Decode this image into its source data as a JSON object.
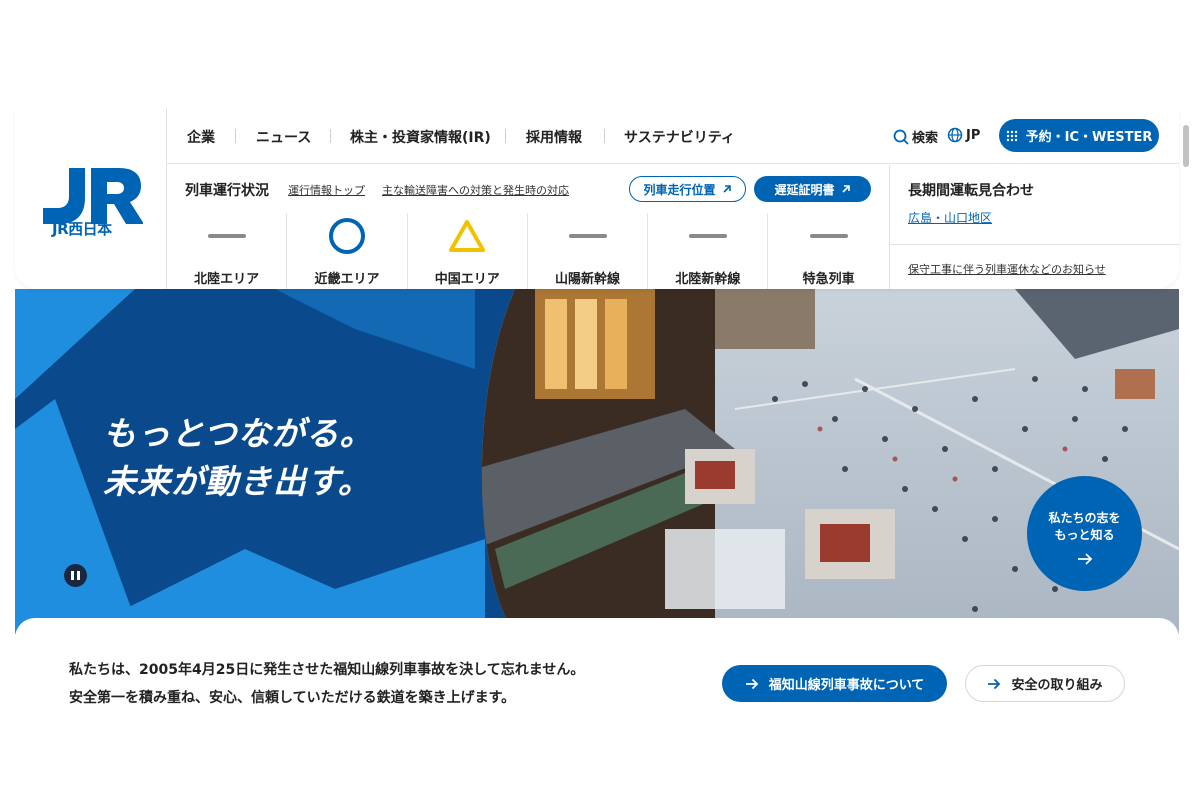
{
  "logo": {
    "sub_label": "JR西日本"
  },
  "top_nav": {
    "items": [
      "企業",
      "ニュース",
      "株主・投資家情報(IR)",
      "採用情報",
      "サステナビリティ"
    ],
    "search_label": "検索",
    "lang_label": "JP",
    "reserve_label": "予約・IC・WESTER"
  },
  "train_status": {
    "title": "列車運行状況",
    "link_top": "運行情報トップ",
    "link_measures": "主な輸送障害への対策と発生時の対応",
    "position_label": "列車走行位置",
    "delay_cert_label": "遅延証明書",
    "areas": [
      {
        "label": "北陸エリア",
        "status_icon": "dash-icon"
      },
      {
        "label": "近畿エリア",
        "status_icon": "circle-icon"
      },
      {
        "label": "中国エリア",
        "status_icon": "triangle-icon"
      },
      {
        "label": "山陽新幹線",
        "status_icon": "dash-icon"
      },
      {
        "label": "北陸新幹線",
        "status_icon": "dash-icon"
      },
      {
        "label": "特急列車",
        "status_icon": "dash-icon"
      }
    ]
  },
  "long_term": {
    "title": "長期間運転見合わせ",
    "link": "広島・山口地区",
    "note": "保守工事に伴う列車運休などのお知らせ"
  },
  "hero": {
    "line1": "もっとつながる。",
    "line2": "未来が動き出す。",
    "mission_line1": "私たちの志を",
    "mission_line2": "もっと知る"
  },
  "safety": {
    "line1": "私たちは、2005年4月25日に発生させた福知山線列車事故を決して忘れません。",
    "line2": "安全第一を積み重ね、安心、信頼していただける鉄道を築き上げます。",
    "primary_btn": "福知山線列車事故について",
    "secondary_btn": "安全の取り組み"
  },
  "colors": {
    "brand": "#0064b4",
    "hero_dark": "#0a4a8c",
    "hero_light": "#1f8ede",
    "status_circle": "#0064b4",
    "status_triangle": "#f2c200",
    "status_dash": "#8a8a8a"
  }
}
